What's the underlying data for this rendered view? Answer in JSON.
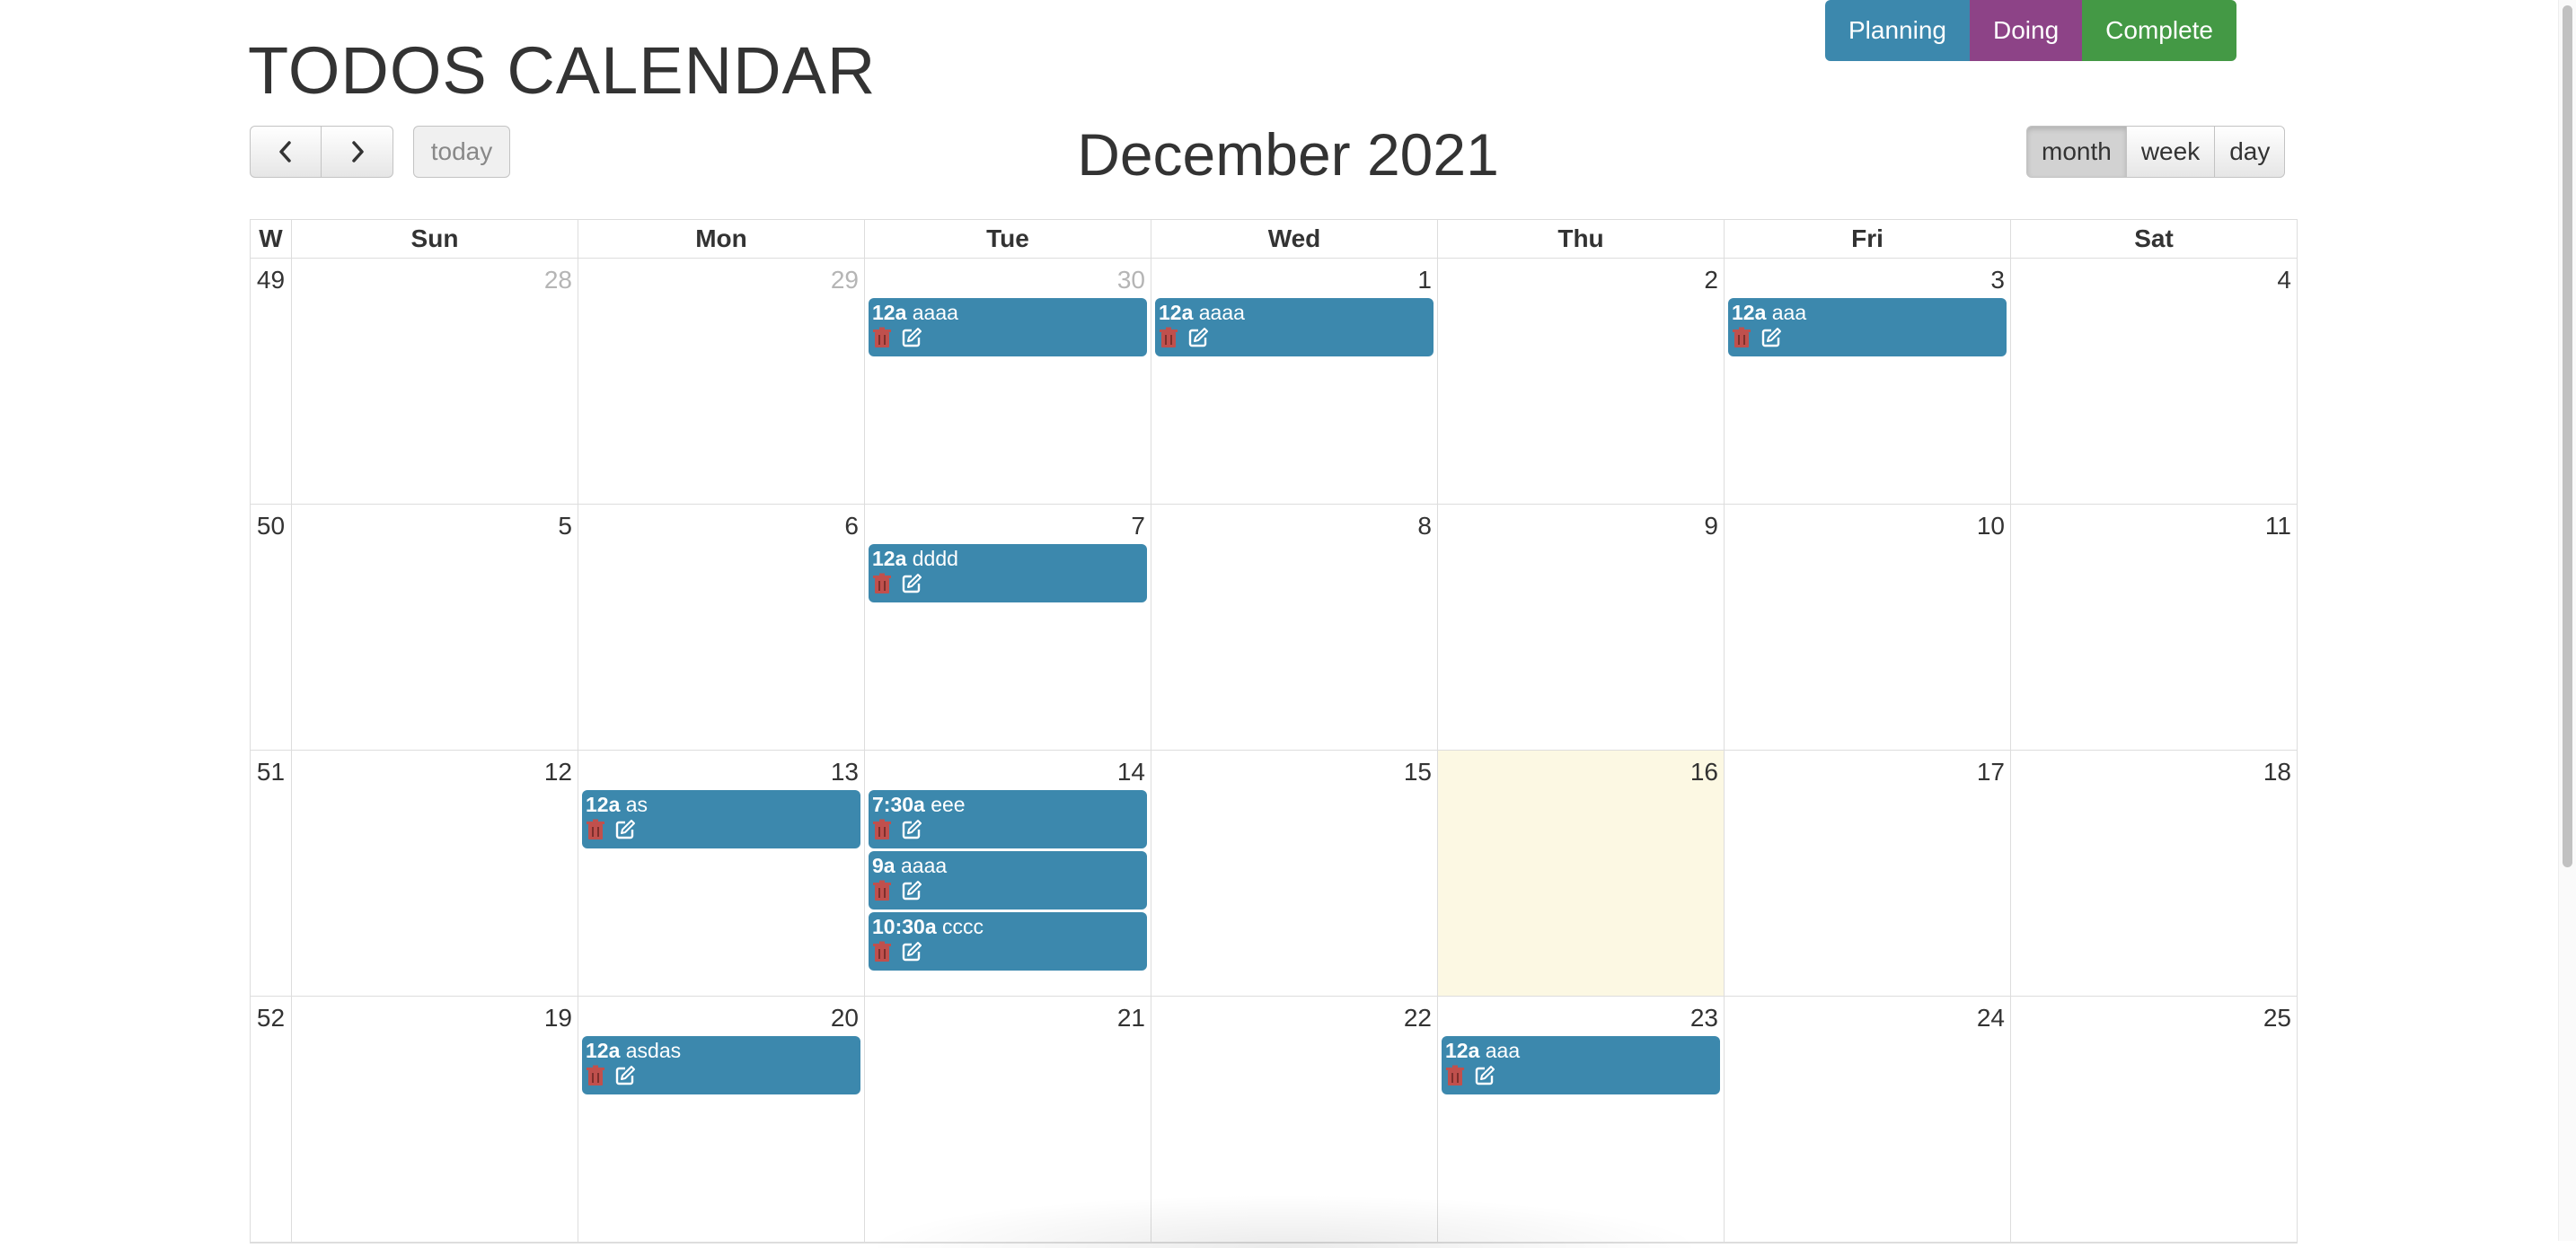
{
  "app": {
    "title": "TODOS CALENDAR"
  },
  "legend": [
    {
      "label": "Planning",
      "color": "#3c88ad"
    },
    {
      "label": "Doing",
      "color": "#8d4387"
    },
    {
      "label": "Complete",
      "color": "#449945"
    }
  ],
  "toolbar": {
    "prev_icon": "chevron-left-icon",
    "next_icon": "chevron-right-icon",
    "today_label": "today",
    "title": "December 2021",
    "views": [
      "month",
      "week",
      "day"
    ],
    "active_view": "month"
  },
  "calendar": {
    "week_header": "W",
    "day_headers": [
      "Sun",
      "Mon",
      "Tue",
      "Wed",
      "Thu",
      "Fri",
      "Sat"
    ],
    "today": "16",
    "event_color": "#3c88ad",
    "weeks": [
      {
        "week": "49",
        "days": [
          {
            "num": "28",
            "other": true,
            "events": []
          },
          {
            "num": "29",
            "other": true,
            "events": []
          },
          {
            "num": "30",
            "other": true,
            "events": [
              {
                "time": "12a",
                "title": "aaaa"
              }
            ]
          },
          {
            "num": "1",
            "events": [
              {
                "time": "12a",
                "title": "aaaa"
              }
            ]
          },
          {
            "num": "2",
            "events": []
          },
          {
            "num": "3",
            "events": [
              {
                "time": "12a",
                "title": "aaa"
              }
            ]
          },
          {
            "num": "4",
            "events": []
          }
        ]
      },
      {
        "week": "50",
        "days": [
          {
            "num": "5",
            "events": []
          },
          {
            "num": "6",
            "events": []
          },
          {
            "num": "7",
            "events": [
              {
                "time": "12a",
                "title": "dddd"
              }
            ]
          },
          {
            "num": "8",
            "events": []
          },
          {
            "num": "9",
            "events": []
          },
          {
            "num": "10",
            "events": []
          },
          {
            "num": "11",
            "events": []
          }
        ]
      },
      {
        "week": "51",
        "days": [
          {
            "num": "12",
            "events": []
          },
          {
            "num": "13",
            "events": [
              {
                "time": "12a",
                "title": "as"
              }
            ]
          },
          {
            "num": "14",
            "events": [
              {
                "time": "7:30a",
                "title": "eee"
              },
              {
                "time": "9a",
                "title": "aaaa"
              },
              {
                "time": "10:30a",
                "title": "cccc"
              }
            ]
          },
          {
            "num": "15",
            "events": []
          },
          {
            "num": "16",
            "today": true,
            "events": []
          },
          {
            "num": "17",
            "events": []
          },
          {
            "num": "18",
            "events": []
          }
        ]
      },
      {
        "week": "52",
        "days": [
          {
            "num": "19",
            "events": []
          },
          {
            "num": "20",
            "events": [
              {
                "time": "12a",
                "title": "asdas"
              }
            ]
          },
          {
            "num": "21",
            "events": []
          },
          {
            "num": "22",
            "events": []
          },
          {
            "num": "23",
            "events": [
              {
                "time": "12a",
                "title": "aaa"
              }
            ]
          },
          {
            "num": "24",
            "events": []
          },
          {
            "num": "25",
            "events": []
          }
        ]
      }
    ]
  }
}
